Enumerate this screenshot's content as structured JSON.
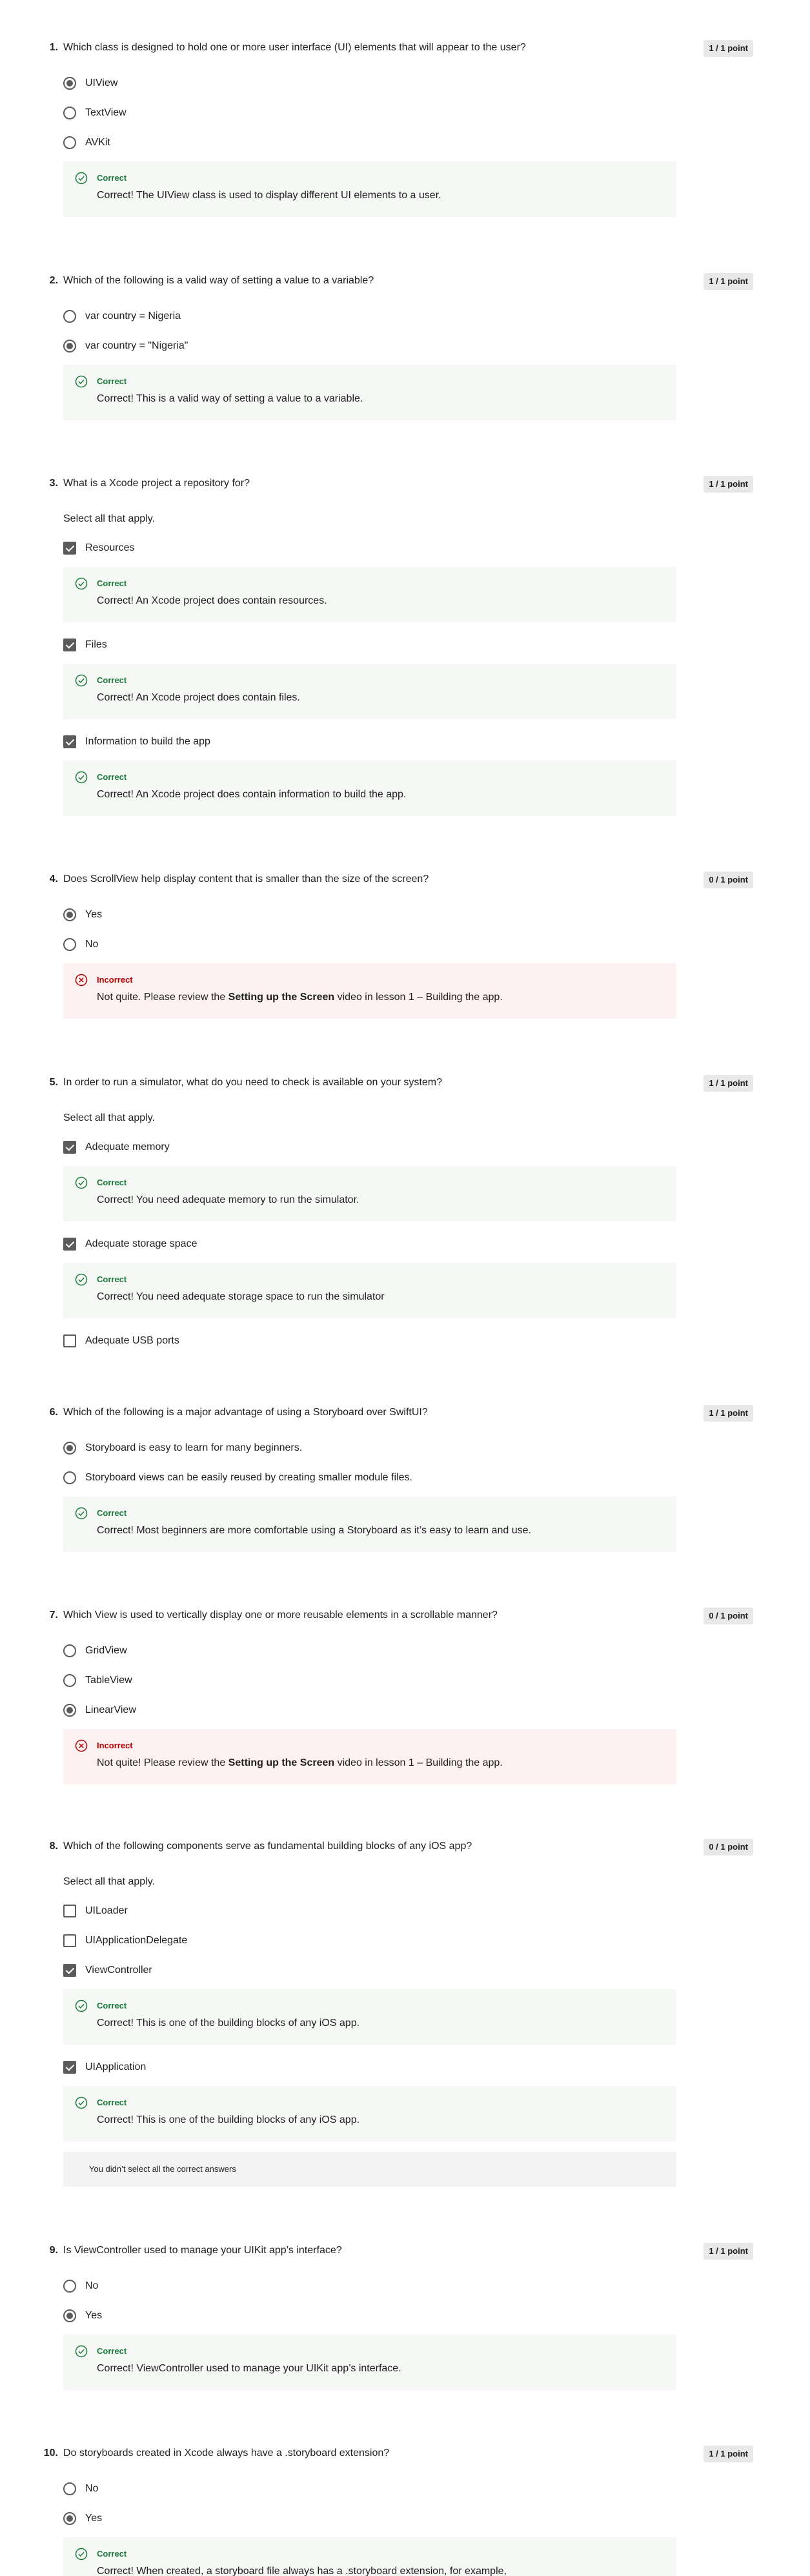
{
  "questions": [
    {
      "num": "1.",
      "text": "Which class is designed to hold one or more user interface (UI) elements that will appear to the user?",
      "points": "1 / 1 point",
      "options": [
        "UIView",
        "TextView",
        "AVKit"
      ],
      "feedback": {
        "title": "Correct",
        "text": "Correct! The UIView class is used to display different UI elements to a user."
      }
    },
    {
      "num": "2.",
      "text": "Which of the following is a valid way of setting a value to a variable?",
      "points": "1 / 1 point",
      "options": [
        "var country = Nigeria",
        "var country = \"Nigeria\""
      ],
      "feedback": {
        "title": "Correct",
        "text": "Correct! This is a valid way of setting a value to a variable."
      }
    },
    {
      "num": "3.",
      "text": "What is a Xcode project a repository for?",
      "points": "1 / 1 point",
      "instruction": "Select all that apply.",
      "options": [
        "Resources",
        "Files",
        "Information to build the app"
      ],
      "feedbacks": [
        {
          "title": "Correct",
          "text": "Correct! An Xcode project does contain resources."
        },
        {
          "title": "Correct",
          "text": "Correct! An Xcode project does contain files."
        },
        {
          "title": "Correct",
          "text": "Correct! An Xcode project does contain information to build the app."
        }
      ]
    },
    {
      "num": "4.",
      "text": "Does ScrollView help display content that is smaller than the size of the screen?",
      "points": "0 / 1 point",
      "options": [
        "Yes",
        "No"
      ],
      "feedback": {
        "title": "Incorrect",
        "pre": "Not quite. Please review the ",
        "bold": "Setting up the Screen",
        "post": " video in lesson 1 – Building the app."
      }
    },
    {
      "num": "5.",
      "text": "In order to run a simulator, what do you need to check is available on your system?",
      "points": "1 / 1 point",
      "instruction": "Select all that apply.",
      "options": [
        "Adequate memory",
        "Adequate storage space",
        "Adequate USB ports"
      ],
      "feedbacks": [
        {
          "title": "Correct",
          "text": "Correct! You need adequate memory to run the simulator."
        },
        {
          "title": "Correct",
          "text": "Correct! You need adequate storage space to run the simulator"
        }
      ]
    },
    {
      "num": "6.",
      "text": "Which of the following is a major advantage of using a Storyboard over SwiftUI?",
      "points": "1 / 1 point",
      "options": [
        "Storyboard is easy to learn for many beginners.",
        "Storyboard views can be easily reused by creating smaller module files."
      ],
      "feedback": {
        "title": "Correct",
        "text": "Correct! Most beginners are more comfortable using a Storyboard as it’s easy to learn and use."
      }
    },
    {
      "num": "7.",
      "text": "Which View is used to vertically display one or more reusable elements in a scrollable manner?",
      "points": "0 / 1 point",
      "options": [
        "GridView",
        "TableView",
        "LinearView"
      ],
      "feedback": {
        "title": "Incorrect",
        "pre": "Not quite! Please review the ",
        "bold": "Setting up the Screen",
        "post": " video in lesson 1 – Building the app."
      }
    },
    {
      "num": "8.",
      "text": "Which of the following components serve as fundamental building blocks of any iOS app?",
      "points": "0 / 1 point",
      "instruction": "Select all that apply.",
      "options": [
        "UILoader",
        "UIApplicationDelegate",
        "ViewController",
        "UIApplication"
      ],
      "feedbacks": [
        {
          "title": "Correct",
          "text": "Correct! This is one of the building blocks of any iOS app."
        },
        {
          "title": "Correct",
          "text": "Correct! This is one of the building blocks of any iOS app."
        }
      ],
      "note": "You didn’t select all the correct answers"
    },
    {
      "num": "9.",
      "text": "Is ViewController used to manage your UIKit app’s interface?",
      "points": "1 / 1 point",
      "options": [
        "No",
        "Yes"
      ],
      "feedback": {
        "title": "Correct",
        "text": "Correct!  ViewController used to manage your UIKit app’s interface."
      }
    },
    {
      "num": "10.",
      "text": "Do storyboards created in Xcode always have a .storyboard extension?",
      "points": "1 / 1 point",
      "options": [
        "No",
        "Yes"
      ],
      "feedback": {
        "title": "Correct",
        "text": "Correct!  When created, a storyboard file always has a .storyboard extension, for example,"
      }
    }
  ],
  "icons": {
    "correct": "check-circle-icon",
    "incorrect": "x-circle-icon"
  },
  "colors": {
    "correct": "#1b7b3b",
    "incorrect": "#b30000",
    "correct_bg": "#f5f8f5",
    "incorrect_bg": "#fdf1f1"
  }
}
